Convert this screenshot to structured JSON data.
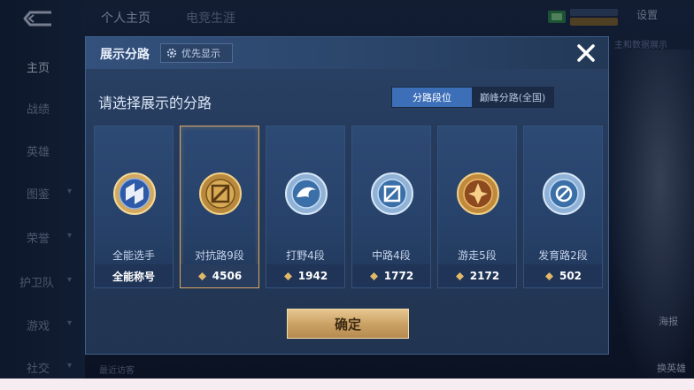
{
  "sidebar": {
    "items": [
      {
        "label": "主页",
        "active": true
      },
      {
        "label": "战绩"
      },
      {
        "label": "英雄"
      },
      {
        "label": "图鉴"
      },
      {
        "label": "荣誉"
      },
      {
        "label": "护卫队"
      },
      {
        "label": "游戏"
      },
      {
        "label": "社交"
      }
    ]
  },
  "topbar": {
    "tabs": [
      "个人主页",
      "电竞生涯"
    ],
    "settings_label": "设置",
    "side_hint": "主和数据展示"
  },
  "background": {
    "recent_visit": "最近访客",
    "portrait_label": "海报",
    "portrait_label2": "换英雄"
  },
  "modal": {
    "title": "展示分路",
    "pref_label": "优先显示",
    "subtitle": "请选择展示的分路",
    "segments": [
      {
        "label": "分路段位",
        "active": true
      },
      {
        "label": "巅峰分路(全国)",
        "active": false
      }
    ],
    "cards": [
      {
        "name": "全能选手",
        "score": "全能称号",
        "emblem": "all-round-emblem-icon",
        "selected": false,
        "show_gem": false
      },
      {
        "name": "对抗路9段",
        "score": "4506",
        "emblem": "clash-lane-emblem-icon",
        "selected": true,
        "show_gem": true
      },
      {
        "name": "打野4段",
        "score": "1942",
        "emblem": "jungle-emblem-icon",
        "selected": false,
        "show_gem": true
      },
      {
        "name": "中路4段",
        "score": "1772",
        "emblem": "mid-lane-emblem-icon",
        "selected": false,
        "show_gem": true
      },
      {
        "name": "游走5段",
        "score": "2172",
        "emblem": "roam-emblem-icon",
        "selected": false,
        "show_gem": true
      },
      {
        "name": "发育路2段",
        "score": "502",
        "emblem": "farm-lane-emblem-icon",
        "selected": false,
        "show_gem": true
      }
    ],
    "confirm_label": "确定"
  },
  "colors": {
    "accent_blue": "#3c6fb8",
    "gold": "#d9a865",
    "panel": "#2a4266"
  }
}
